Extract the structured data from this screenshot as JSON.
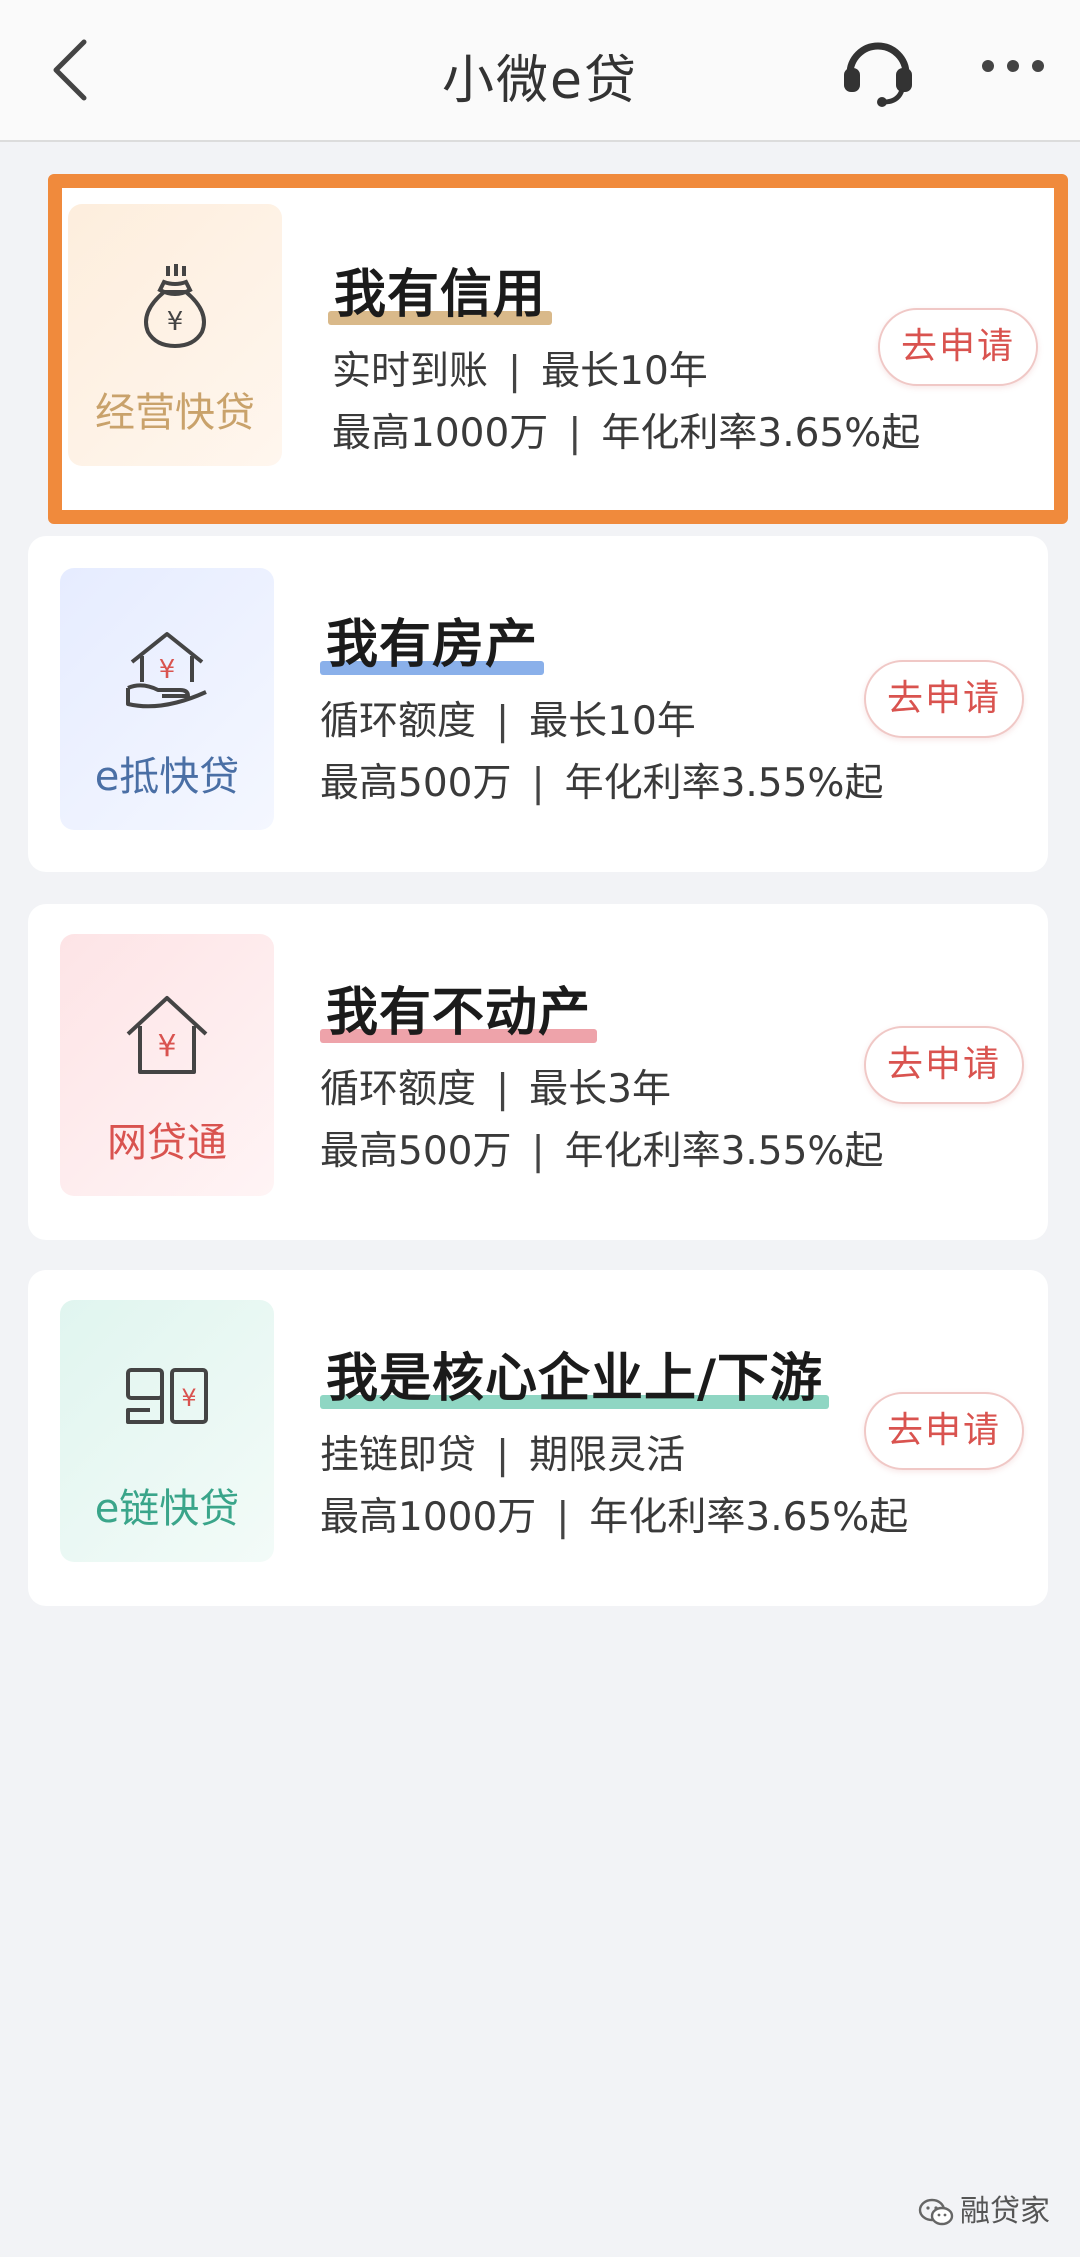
{
  "header": {
    "title": "小微e贷",
    "back_icon": "chevron-left-icon",
    "support_icon": "headset-icon",
    "more_icon": "more-dots-icon"
  },
  "products": [
    {
      "tile_label": "经营快贷",
      "tile_icon": "money-bag-yen-icon",
      "heading": "我有信用",
      "line1": [
        "实时到账",
        "最长10年"
      ],
      "line2": [
        "最高1000万",
        "年化利率3.65%起"
      ],
      "apply_label": "去申请",
      "accent": "#c9a26b",
      "highlight_border": "#f08a3c"
    },
    {
      "tile_label": "e抵快贷",
      "tile_icon": "house-hand-yen-icon",
      "heading": "我有房产",
      "line1": [
        "循环额度",
        "最长10年"
      ],
      "line2": [
        "最高500万",
        "年化利率3.55%起"
      ],
      "apply_label": "去申请",
      "accent": "#6f9ee0"
    },
    {
      "tile_label": "网贷通",
      "tile_icon": "house-yen-icon",
      "heading": "我有不动产",
      "line1": [
        "循环额度",
        "最长3年"
      ],
      "line2": [
        "最高500万",
        "年化利率3.55%起"
      ],
      "apply_label": "去申请",
      "accent": "#e89aa2"
    },
    {
      "tile_label": "e链快贷",
      "tile_icon": "chain-blocks-yen-icon",
      "heading": "我是核心企业上/下游",
      "line1": [
        "挂链即贷",
        "期限灵活"
      ],
      "line2": [
        "最高1000万",
        "年化利率3.65%起"
      ],
      "apply_label": "去申请",
      "accent": "#7fcdb8"
    }
  ],
  "watermark": {
    "text": "融贷家",
    "icon": "wechat-icon"
  }
}
